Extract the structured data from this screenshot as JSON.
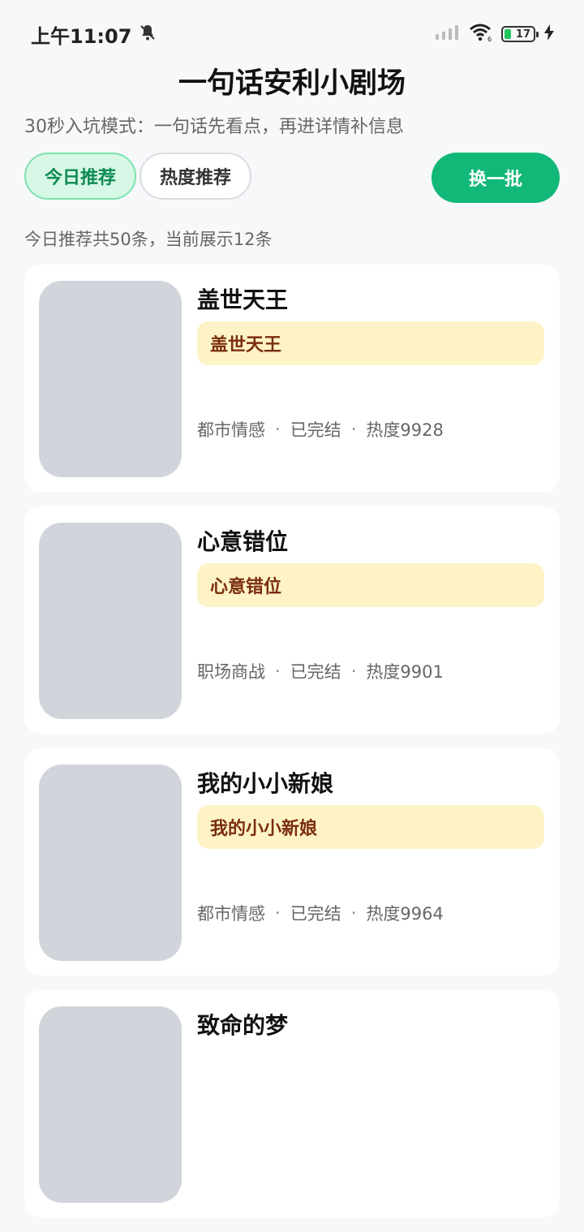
{
  "status_bar": {
    "time": "上午11:07",
    "battery": "17"
  },
  "header": {
    "title": "一句话安利小剧场",
    "subtitle": "30秒入坑模式：一句话先看点，再进详情补信息"
  },
  "tabs": [
    {
      "label": "今日推荐",
      "active": true
    },
    {
      "label": "热度推荐",
      "active": false
    }
  ],
  "refresh_label": "换一批",
  "count_text": "今日推荐共50条，当前展示12条",
  "cards": [
    {
      "title": "盖世天王",
      "hook": "盖世天王",
      "genre": "都市情感",
      "status": "已完结",
      "heat": "热度9928"
    },
    {
      "title": "心意错位",
      "hook": "心意错位",
      "genre": "职场商战",
      "status": "已完结",
      "heat": "热度9901"
    },
    {
      "title": "我的小小新娘",
      "hook": "我的小小新娘",
      "genre": "都市情感",
      "status": "已完结",
      "heat": "热度9964"
    },
    {
      "title": "致命的梦"
    }
  ],
  "colors": {
    "accent": "#12b878",
    "hook_bg": "#fef3c7",
    "hook_text": "#7a2e0e",
    "cover_placeholder": "#d1d5db"
  }
}
